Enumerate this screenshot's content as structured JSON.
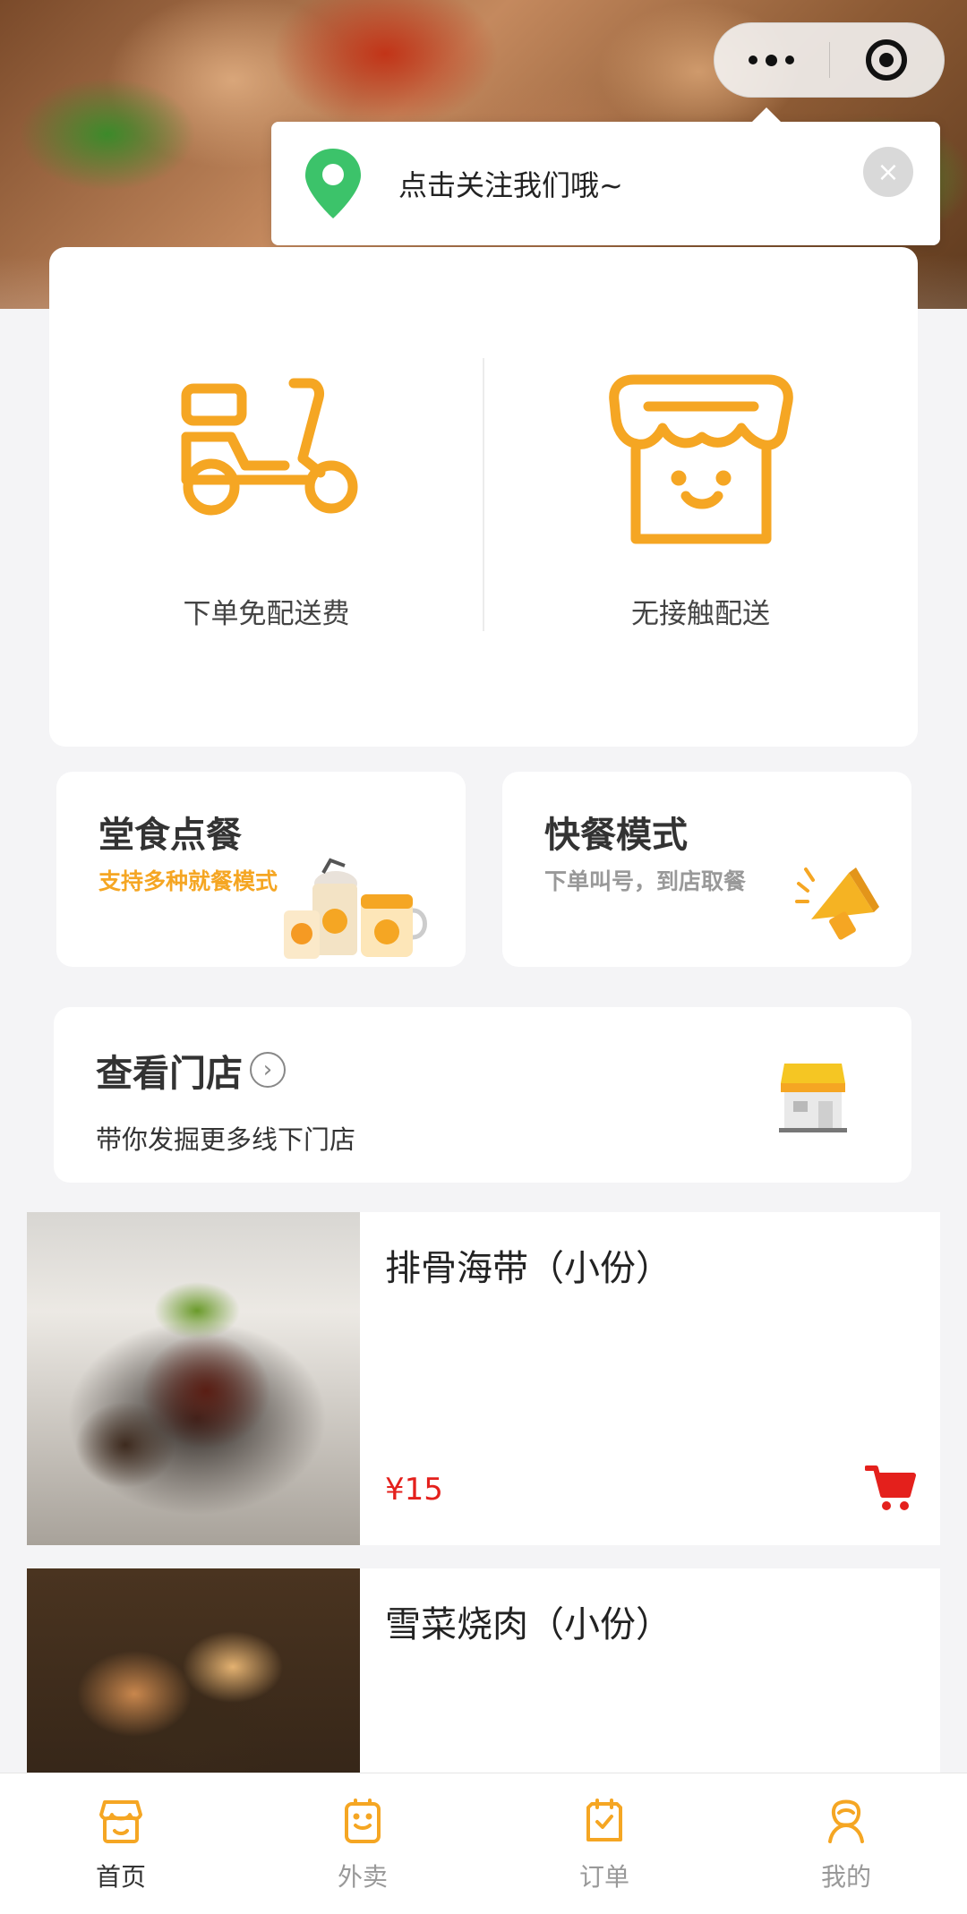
{
  "capsule": {
    "more_icon": "more-dots-icon",
    "close_icon": "target-close-icon"
  },
  "follow_tip": {
    "text": "点击关注我们哦~",
    "icon": "location-pin-icon",
    "close": "×"
  },
  "features": [
    {
      "label": "下单免配送费",
      "icon": "scooter-icon"
    },
    {
      "label": "无接触配送",
      "icon": "smiling-shop-icon"
    }
  ],
  "modes": [
    {
      "title": "堂食点餐",
      "subtitle": "支持多种就餐模式",
      "subtitle_color": "#f5a623"
    },
    {
      "title": "快餐模式",
      "subtitle": "下单叫号，到店取餐",
      "subtitle_color": "#999999"
    }
  ],
  "store": {
    "title": "查看门店",
    "chevron": "›",
    "subtitle": "带你发掘更多线下门店"
  },
  "dishes": [
    {
      "name": "排骨海带（小份）",
      "price": "¥15"
    },
    {
      "name": "雪菜烧肉（小份）",
      "price": ""
    }
  ],
  "tabs": [
    {
      "label": "首页",
      "icon": "home-shop-icon",
      "active": true
    },
    {
      "label": "外卖",
      "icon": "takeout-icon",
      "active": false
    },
    {
      "label": "订单",
      "icon": "order-icon",
      "active": false
    },
    {
      "label": "我的",
      "icon": "profile-icon",
      "active": false
    }
  ],
  "colors": {
    "accent": "#f5a623",
    "price": "#e4201c"
  }
}
